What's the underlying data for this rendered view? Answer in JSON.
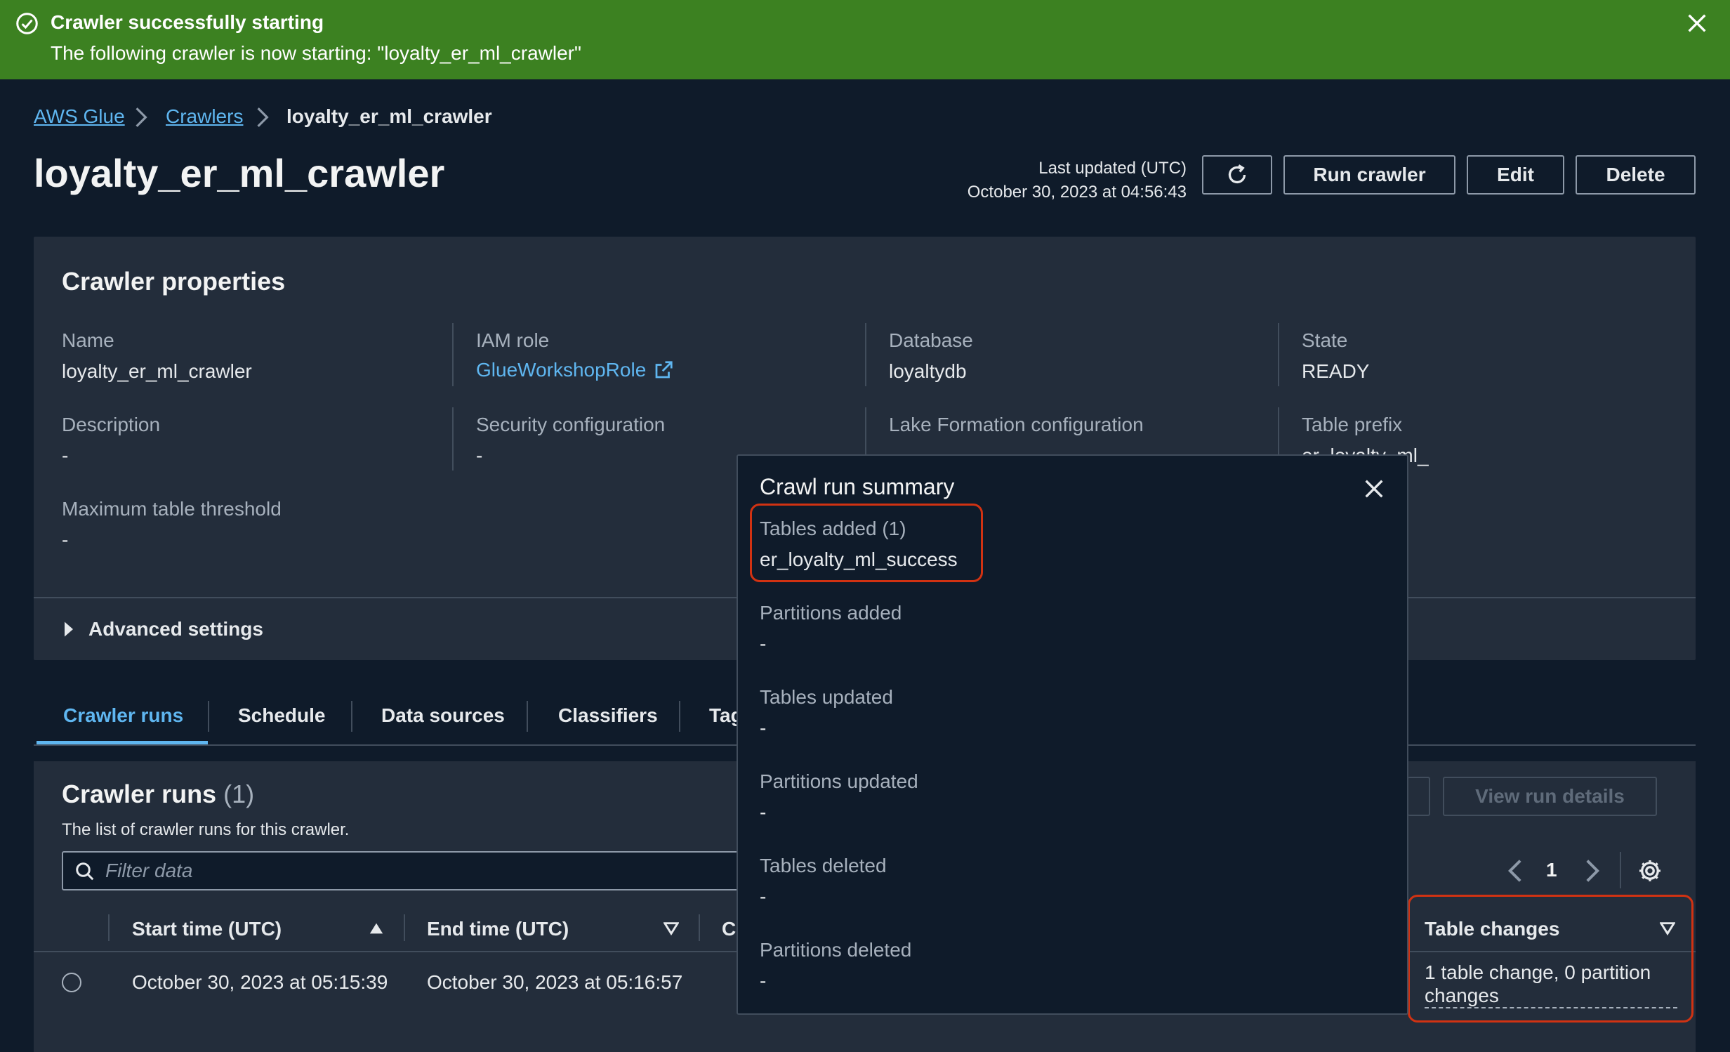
{
  "flash": {
    "title": "Crawler successfully starting",
    "message": "The following crawler is now starting: \"loyalty_er_ml_crawler\"",
    "color": "#3c8121"
  },
  "breadcrumb": {
    "items": [
      "AWS Glue",
      "Crawlers",
      "loyalty_er_ml_crawler"
    ]
  },
  "page": {
    "title": "loyalty_er_ml_crawler",
    "last_updated_label": "Last updated (UTC)",
    "last_updated_value": "October 30, 2023 at 04:56:43"
  },
  "actions": {
    "refresh_icon": "refresh-icon",
    "run": "Run crawler",
    "edit": "Edit",
    "delete": "Delete"
  },
  "properties": {
    "title": "Crawler properties",
    "name_label": "Name",
    "name_value": "loyalty_er_ml_crawler",
    "iam_label": "IAM role",
    "iam_value": "GlueWorkshopRole",
    "database_label": "Database",
    "database_value": "loyaltydb",
    "state_label": "State",
    "state_value": "READY",
    "description_label": "Description",
    "description_value": "-",
    "security_label": "Security configuration",
    "security_value": "-",
    "lakeformation_label": "Lake Formation configuration",
    "prefix_label": "Table prefix",
    "prefix_value": "er_loyalty_ml_",
    "max_threshold_label": "Maximum table threshold",
    "max_threshold_value": "-",
    "advanced": "Advanced settings"
  },
  "tabs": [
    {
      "label": "Crawler runs"
    },
    {
      "label": "Schedule"
    },
    {
      "label": "Data sources"
    },
    {
      "label": "Classifiers"
    },
    {
      "label": "Tags"
    }
  ],
  "runs": {
    "title": "Crawler runs",
    "count": "(1)",
    "description": "The list of crawler runs for this crawler.",
    "filter_placeholder": "Filter data",
    "view_details": "View run details",
    "page": "1",
    "columns": [
      "Start time (UTC)",
      "End time (UTC)",
      "C",
      "Table changes"
    ],
    "rows": [
      {
        "start": "October 30, 2023 at 05:15:39",
        "end": "October 30, 2023 at 05:16:57",
        "changes": "1 table change, 0 partition changes"
      }
    ]
  },
  "popover": {
    "title": "Crawl run summary",
    "tables_added_label": "Tables added (1)",
    "tables_added_value": "er_loyalty_ml_success",
    "partitions_added_label": "Partitions added",
    "partitions_added_value": "-",
    "tables_updated_label": "Tables updated",
    "tables_updated_value": "-",
    "partitions_updated_label": "Partitions updated",
    "partitions_updated_value": "-",
    "tables_deleted_label": "Tables deleted",
    "tables_deleted_value": "-",
    "partitions_deleted_label": "Partitions deleted",
    "partitions_deleted_value": "-"
  },
  "colors": {
    "link": "#5fb6f0",
    "highlight": "#d13212",
    "background": "#0f1b2a",
    "panel": "#232d3b"
  }
}
